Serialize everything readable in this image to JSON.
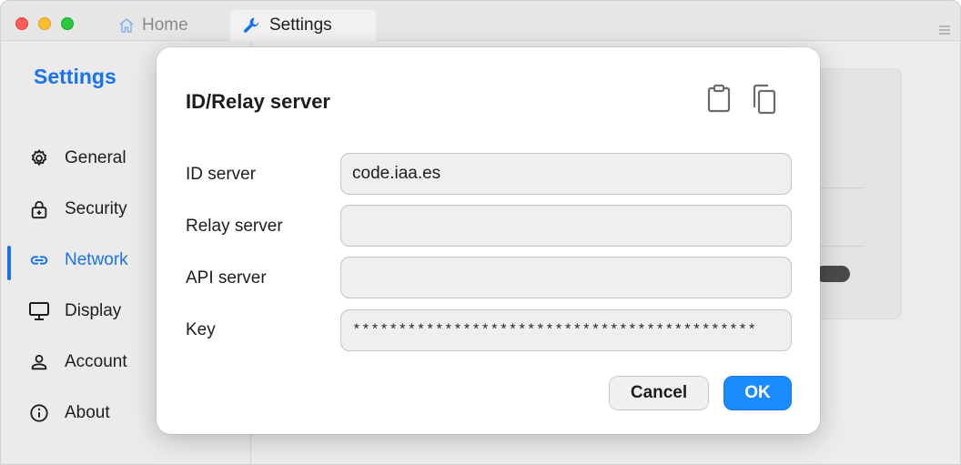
{
  "titlebar": {
    "tabs": [
      {
        "label": "Home",
        "icon": "home-icon"
      },
      {
        "label": "Settings",
        "icon": "wrench-icon"
      }
    ],
    "menu_icon": "hamburger-icon"
  },
  "sidebar": {
    "title": "Settings",
    "items": [
      {
        "label": "General",
        "icon": "gear-icon"
      },
      {
        "label": "Security",
        "icon": "lock-icon"
      },
      {
        "label": "Network",
        "icon": "link-icon",
        "active": true
      },
      {
        "label": "Display",
        "icon": "monitor-icon"
      },
      {
        "label": "Account",
        "icon": "person-icon"
      },
      {
        "label": "About",
        "icon": "info-icon"
      }
    ]
  },
  "dialog": {
    "title": "ID/Relay server",
    "fields": [
      {
        "label": "ID server",
        "value": "code.iaa.es"
      },
      {
        "label": "Relay server",
        "value": ""
      },
      {
        "label": "API server",
        "value": ""
      },
      {
        "label": "Key",
        "value": "********************************************"
      }
    ],
    "cancel_label": "Cancel",
    "ok_label": "OK"
  },
  "colors": {
    "accent": "#1a73e8",
    "ok_button": "#1a8cff",
    "traffic_red": "#ff5f57",
    "traffic_yellow": "#febc2e",
    "traffic_green": "#28c840"
  }
}
